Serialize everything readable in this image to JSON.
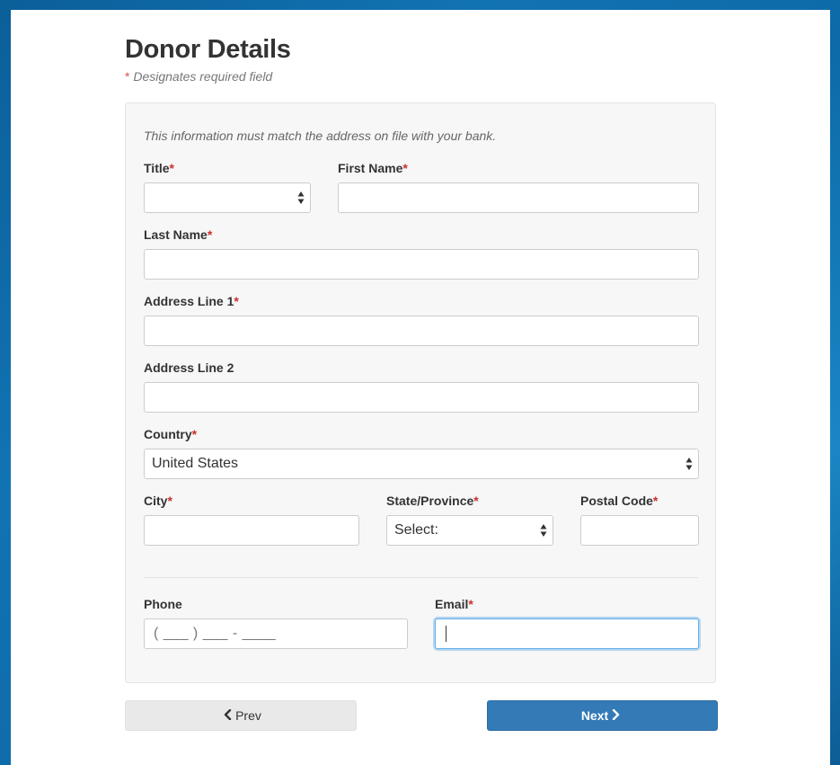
{
  "page": {
    "title": "Donor Details",
    "required_star": "*",
    "required_note": "Designates required field"
  },
  "form": {
    "intro": "This information must match the address on file with your bank.",
    "fields": {
      "title": {
        "label": "Title",
        "required": "*",
        "value": ""
      },
      "first_name": {
        "label": "First Name",
        "required": "*",
        "value": ""
      },
      "last_name": {
        "label": "Last Name",
        "required": "*",
        "value": ""
      },
      "address1": {
        "label": "Address Line 1",
        "required": "*",
        "value": ""
      },
      "address2": {
        "label": "Address Line 2",
        "value": ""
      },
      "country": {
        "label": "Country",
        "required": "*",
        "value": "United States"
      },
      "city": {
        "label": "City",
        "required": "*",
        "value": ""
      },
      "state": {
        "label": "State/Province",
        "required": "*",
        "value": "Select:"
      },
      "postal": {
        "label": "Postal Code",
        "required": "*",
        "value": ""
      },
      "phone": {
        "label": "Phone",
        "mask": "( ___ ) ___ - ____"
      },
      "email": {
        "label": "Email",
        "required": "*",
        "value": ""
      }
    }
  },
  "buttons": {
    "prev_label": "Prev",
    "next_label": "Next"
  },
  "icons": {
    "prev": "chevron-left-icon",
    "next": "chevron-right-icon",
    "select": "select-arrows-icon"
  },
  "colors": {
    "required": "#c9302c",
    "primary_button": "#337ab7",
    "focus": "#66afe9"
  }
}
